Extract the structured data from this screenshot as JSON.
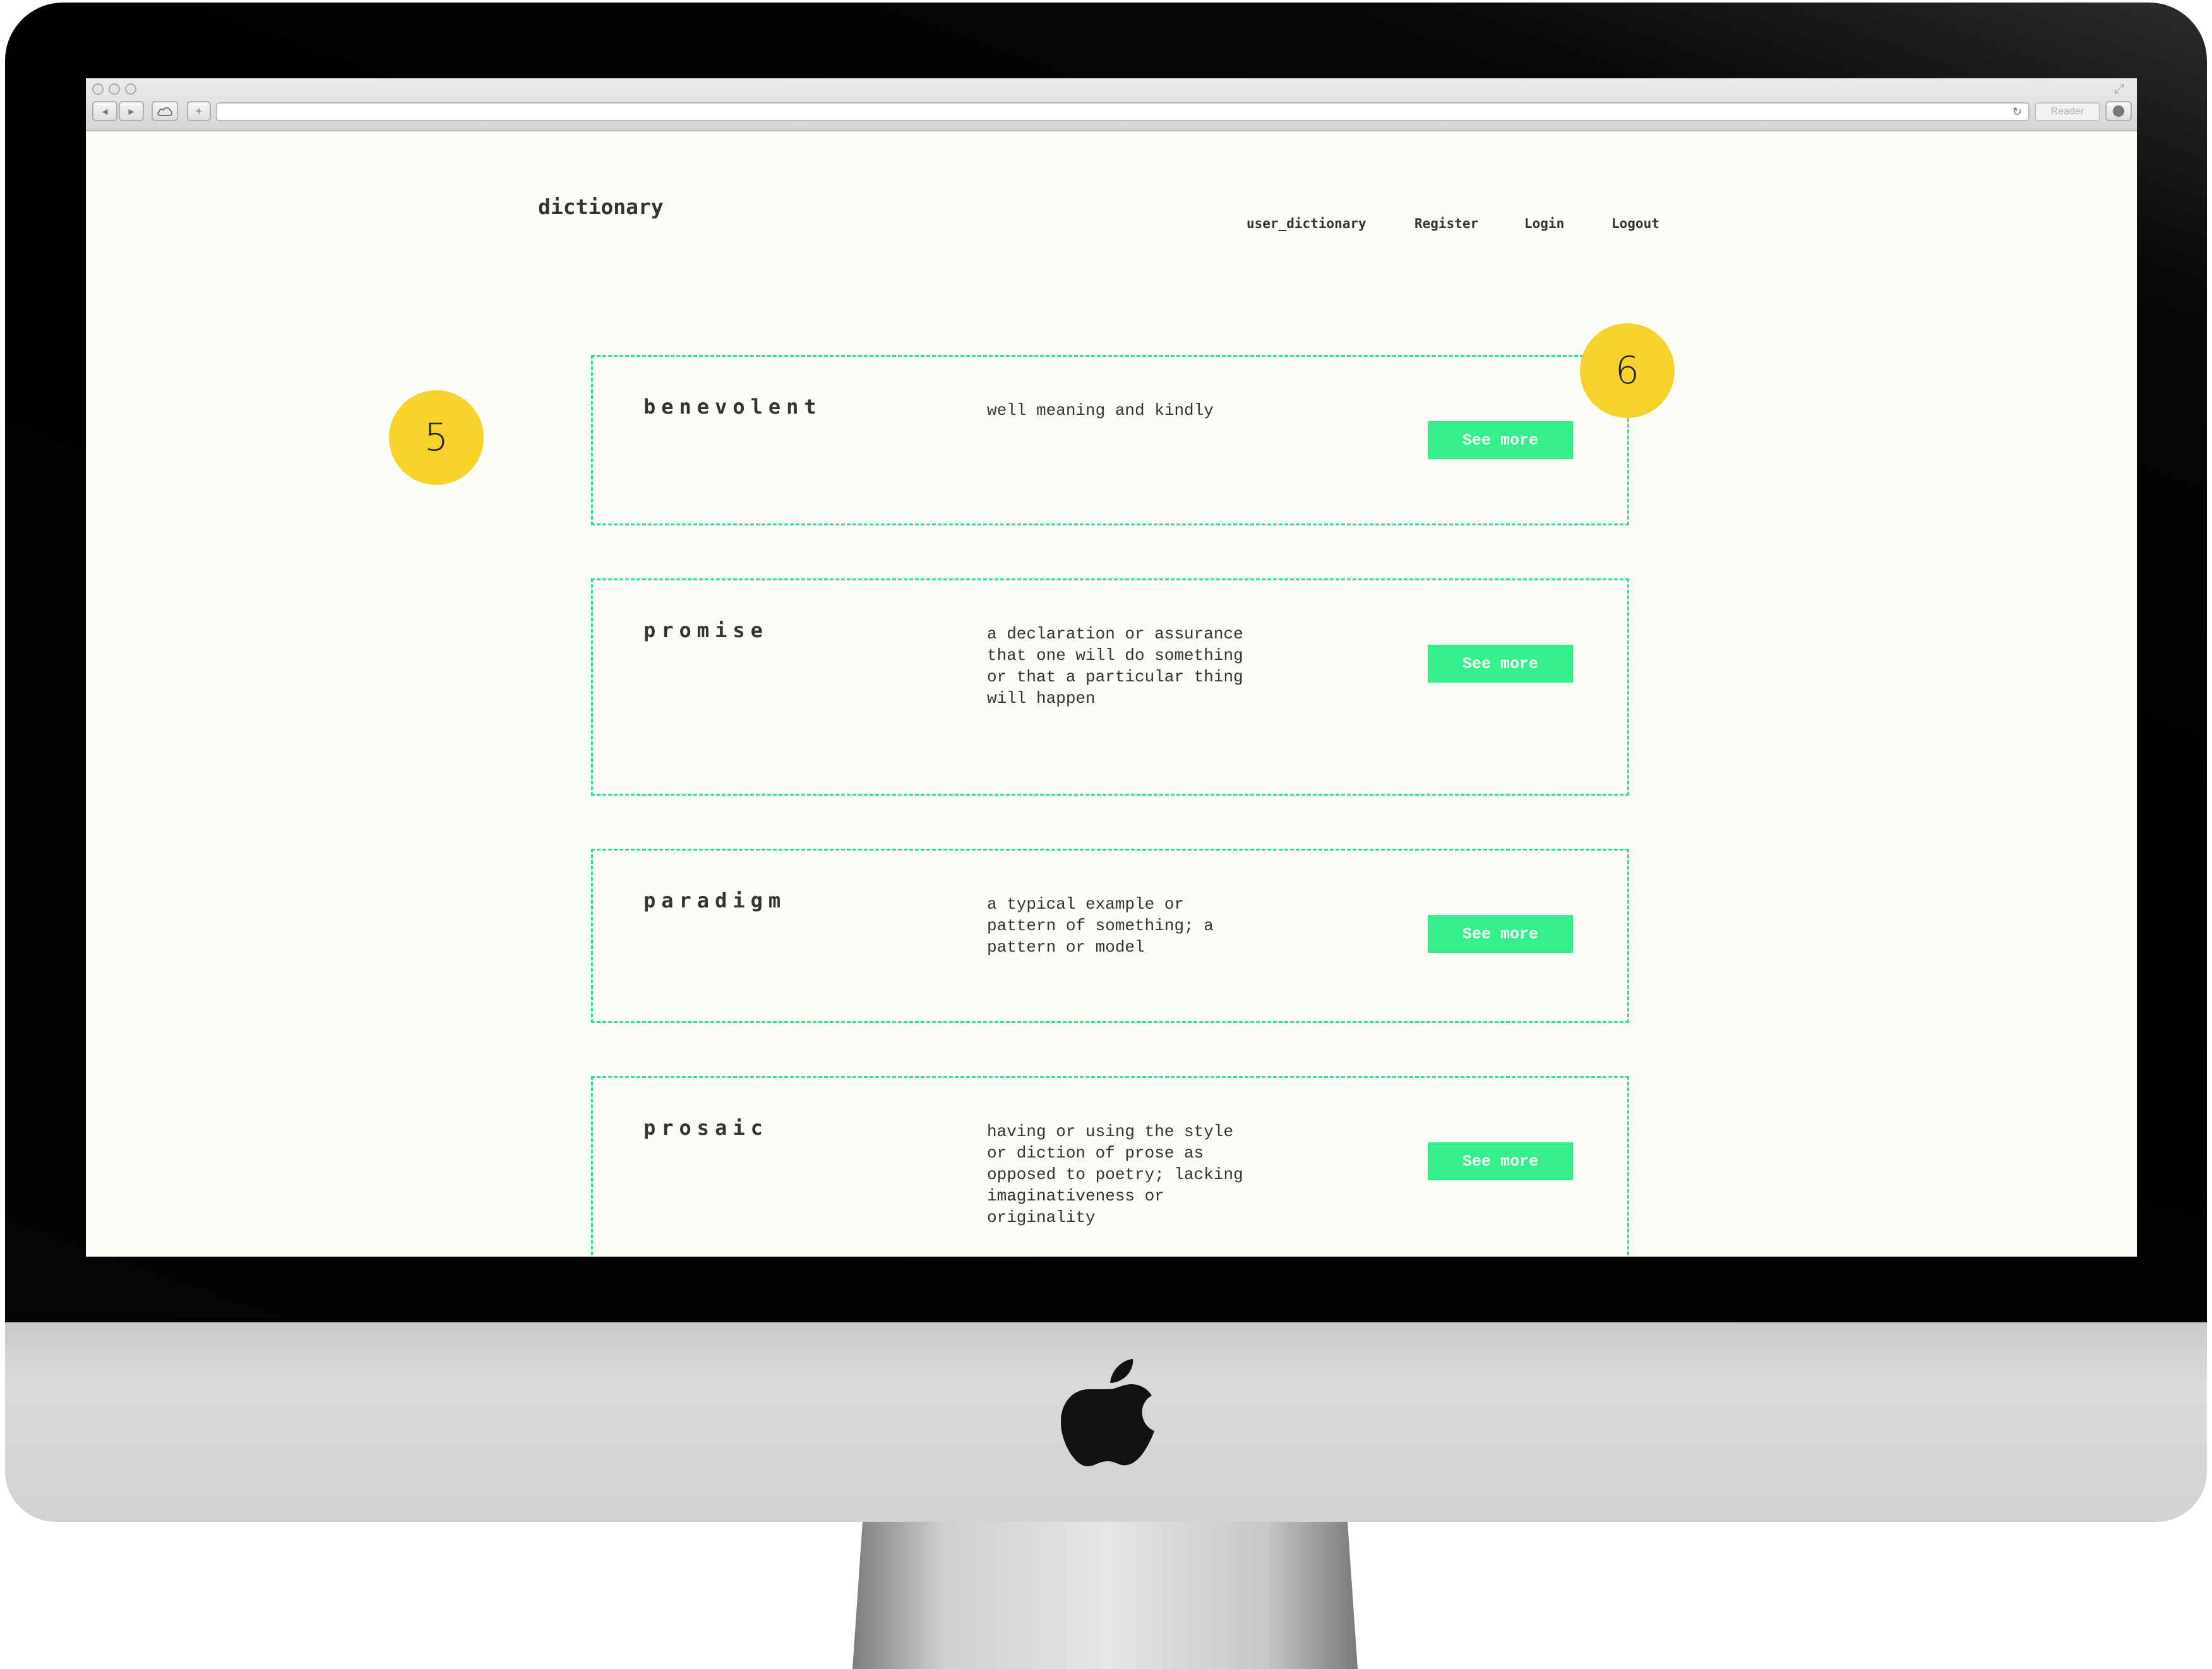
{
  "site": {
    "logo": "dictionary",
    "nav": [
      "user_dictionary",
      "Register",
      "Login",
      "Logout"
    ]
  },
  "browser": {
    "reader_label": "Reader",
    "reload_glyph": "↻",
    "plus_glyph": "+",
    "expand_glyph": "⤢"
  },
  "entries": [
    {
      "word": "benevolent",
      "definition": "well meaning and kindly",
      "button": "See more"
    },
    {
      "word": "promise",
      "definition": "a declaration or assurance that one will do something or that a particular thing will happen",
      "button": "See more"
    },
    {
      "word": "paradigm",
      "definition": "a typical example or pattern of something; a pattern or model",
      "button": "See more"
    },
    {
      "word": "prosaic",
      "definition": "having or using the style or diction of prose as opposed to poetry; lacking imaginativeness or originality",
      "button": "See more"
    }
  ],
  "badges": [
    "5",
    "6"
  ],
  "colors": {
    "accent": "#37ef8a",
    "border": "#2fe28e",
    "badge": "#f6d22a",
    "page_bg": "#fcfcf7",
    "text": "#333333"
  },
  "icons": [
    "back-arrow-icon",
    "forward-arrow-icon",
    "cloud-icon",
    "plus-icon",
    "reload-icon",
    "download-icon",
    "expand-icon",
    "apple-logo-icon"
  ]
}
